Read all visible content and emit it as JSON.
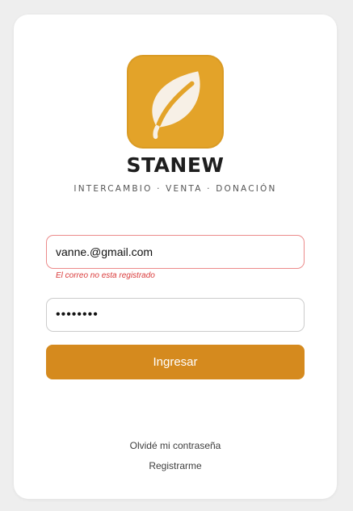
{
  "brand": {
    "logo_icon": "leaf-icon",
    "name": "STANEW",
    "tagline": "INTERCAMBIO · VENTA · DONACIÓN"
  },
  "form": {
    "email_value": "vanne.@gmail.com",
    "email_error": "El correo no esta registrado",
    "password_value": "••••••••",
    "submit_label": "Ingresar"
  },
  "links": {
    "forgot_password": "Olvidé mi contraseña",
    "register": "Registrarme"
  },
  "colors": {
    "accent": "#d58a1e",
    "logo_bg": "#e3a329",
    "error": "#d93a3a"
  }
}
